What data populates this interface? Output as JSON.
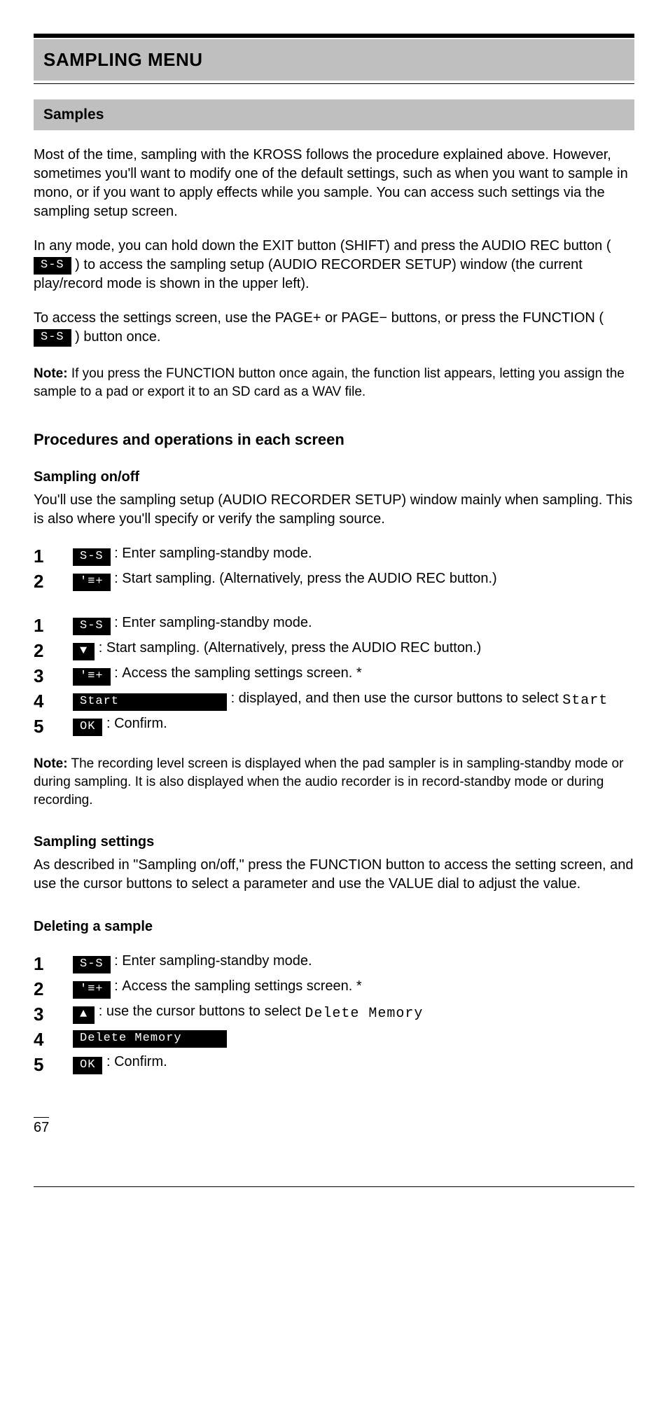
{
  "h1": "SAMPLING MENU",
  "h2": "Samples",
  "band_intro": "",
  "intro_para": "Most of the time, sampling with the KROSS follows the procedure explained above. However, sometimes you'll want to modify one of the default settings, such as when you want to sample in mono, or if you want to apply effects while you sample. You can access such settings via the sampling setup screen.",
  "inline_p1a": "In any mode, you can hold down the EXIT button (SHIFT) and press the AUDIO REC button (",
  "inline_p1b": ") to access the sampling setup (AUDIO RECORDER SETUP) window (the current play/record mode is shown in the upper left).",
  "inline_p2a": "To access the settings screen, use the PAGE+ or PAGE− buttons, or press the FUNCTION (",
  "inline_p2b": ") button once.",
  "note1_label": "Note:",
  "note1_text": "If you press the FUNCTION button once again, the function list appears, letting you assign the sample to a pad or export it to an SD card as a WAV file.",
  "steps_title": "Procedures and operations in each screen",
  "sampling_on_off_title": "Sampling on/off",
  "sampling_on_off_intro": "You'll use the sampling setup (AUDIO RECORDER SETUP) window mainly when sampling. This is also where you'll specify or verify the sampling source.",
  "step1_txt": "Enter sampling-standby mode.",
  "step2_txt": "Start sampling. (Alternatively, press the AUDIO REC button.)",
  "step3_txt": "Access the sampling settings screen. *",
  "step4_1": "",
  "step4_2a": ": displayed, and then use the cursor buttons to select",
  "step4_2b": "Start",
  "step5_txt": "Confirm.",
  "note2_label": "Note:",
  "note2_text": "The recording level screen is displayed when the pad sampler is in sampling-standby mode or during sampling. It is also displayed when the audio recorder is in record-standby mode or during recording.",
  "sampling_settings_title": "Sampling settings",
  "sampling_settings_intro": "As described in \"Sampling on/off,\" press the FUNCTION button to access the setting screen, and use the cursor buttons to select a parameter and use the VALUE dial to adjust the value.",
  "delete_title": "Deleting a sample",
  "step_d1_txt": "Enter sampling-standby mode.",
  "step_d2_txt": "Access the sampling settings screen. *",
  "step_d3a": ": use the cursor buttons to select",
  "step_d3b": "Delete Memory",
  "step_d4_txt": "",
  "step_d5_txt": "Confirm.",
  "ss_label": "S-S",
  "k_list": "'≡+",
  "k_start_btn": "Start",
  "k_ok": " OK ",
  "k_down": "▼",
  "k_up": "▲",
  "k_delmem": "Delete Memory",
  "page_num": "67"
}
